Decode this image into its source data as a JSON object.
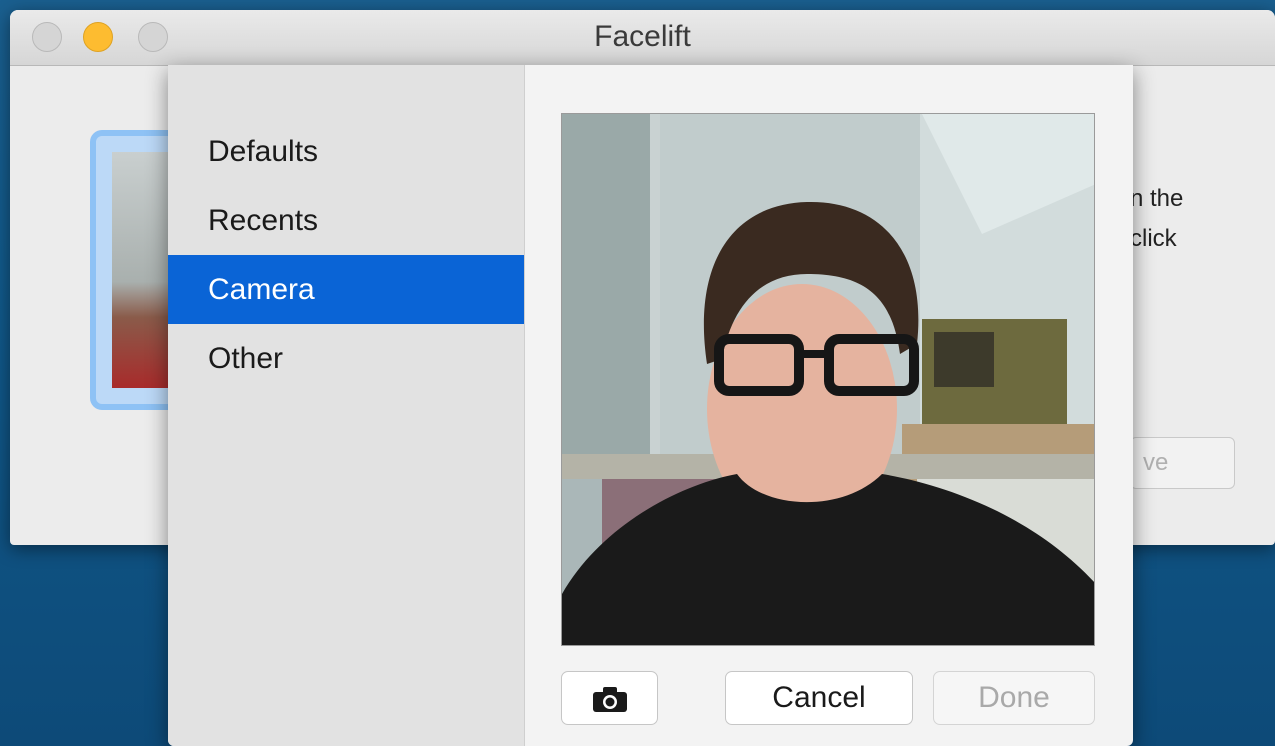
{
  "window": {
    "title": "Facelift",
    "background_text_line1": "n the",
    "background_text_line2": "click",
    "background_button_label": "ve"
  },
  "picker": {
    "sources": [
      {
        "label": "Defaults",
        "selected": false
      },
      {
        "label": "Recents",
        "selected": false
      },
      {
        "label": "Camera",
        "selected": true
      },
      {
        "label": "Other",
        "selected": false
      }
    ],
    "camera_button_icon": "camera-icon",
    "cancel_label": "Cancel",
    "done_label": "Done"
  },
  "colors": {
    "selection": "#0a64d6",
    "minimize": "#fdbc30",
    "avatar_highlight": "#8ec2f5"
  }
}
